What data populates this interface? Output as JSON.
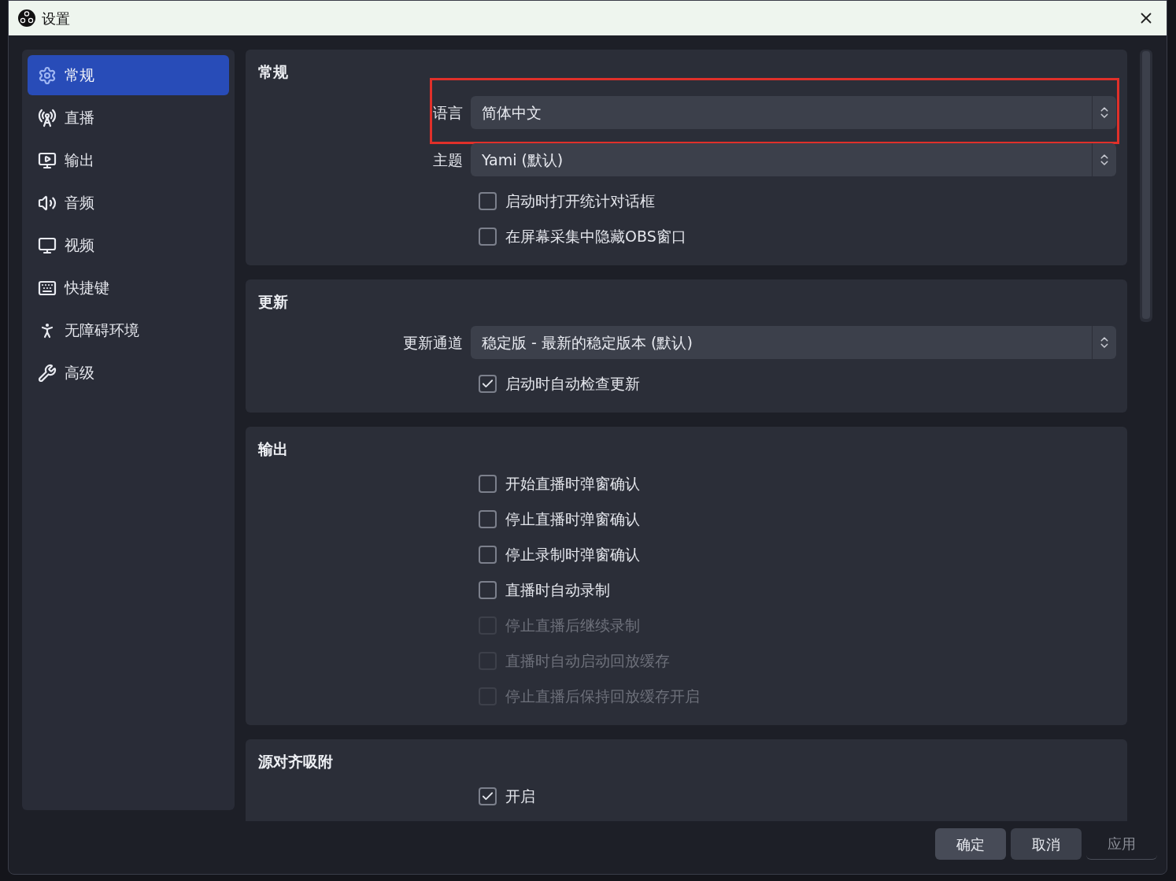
{
  "window": {
    "title": "设置"
  },
  "sidebar": {
    "items": [
      {
        "label": "常规",
        "selected": true
      },
      {
        "label": "直播",
        "selected": false
      },
      {
        "label": "输出",
        "selected": false
      },
      {
        "label": "音频",
        "selected": false
      },
      {
        "label": "视频",
        "selected": false
      },
      {
        "label": "快捷键",
        "selected": false
      },
      {
        "label": "无障碍环境",
        "selected": false
      },
      {
        "label": "高级",
        "selected": false
      }
    ]
  },
  "sections": [
    {
      "title": "常规",
      "rows": [
        {
          "kind": "select",
          "label": "语言",
          "value": "简体中文",
          "highlighted": true
        },
        {
          "kind": "select",
          "label": "主题",
          "value": "Yami (默认)",
          "highlighted": false
        },
        {
          "kind": "checkbox",
          "label": "启动时打开统计对话框",
          "checked": false,
          "disabled": false
        },
        {
          "kind": "checkbox",
          "label": "在屏幕采集中隐藏OBS窗口",
          "checked": false,
          "disabled": false
        }
      ]
    },
    {
      "title": "更新",
      "rows": [
        {
          "kind": "select",
          "label": "更新通道",
          "value": "稳定版 - 最新的稳定版本 (默认)",
          "highlighted": false
        },
        {
          "kind": "checkbox",
          "label": "启动时自动检查更新",
          "checked": true,
          "disabled": false
        }
      ]
    },
    {
      "title": "输出",
      "rows": [
        {
          "kind": "checkbox",
          "label": "开始直播时弹窗确认",
          "checked": false,
          "disabled": false
        },
        {
          "kind": "checkbox",
          "label": "停止直播时弹窗确认",
          "checked": false,
          "disabled": false
        },
        {
          "kind": "checkbox",
          "label": "停止录制时弹窗确认",
          "checked": false,
          "disabled": false
        },
        {
          "kind": "checkbox",
          "label": "直播时自动录制",
          "checked": false,
          "disabled": false
        },
        {
          "kind": "checkbox",
          "label": "停止直播后继续录制",
          "checked": false,
          "disabled": true
        },
        {
          "kind": "checkbox",
          "label": "直播时自动启动回放缓存",
          "checked": false,
          "disabled": true
        },
        {
          "kind": "checkbox",
          "label": "停止直播后保持回放缓存开启",
          "checked": false,
          "disabled": true
        }
      ]
    },
    {
      "title": "源对齐吸附",
      "rows": [
        {
          "kind": "checkbox",
          "label": "开启",
          "checked": true,
          "disabled": false
        }
      ]
    }
  ],
  "buttons": [
    {
      "label": "确定",
      "kind": "primary",
      "disabled": false
    },
    {
      "label": "取消",
      "kind": "normal",
      "disabled": false
    },
    {
      "label": "应用",
      "kind": "normal",
      "disabled": true
    }
  ]
}
